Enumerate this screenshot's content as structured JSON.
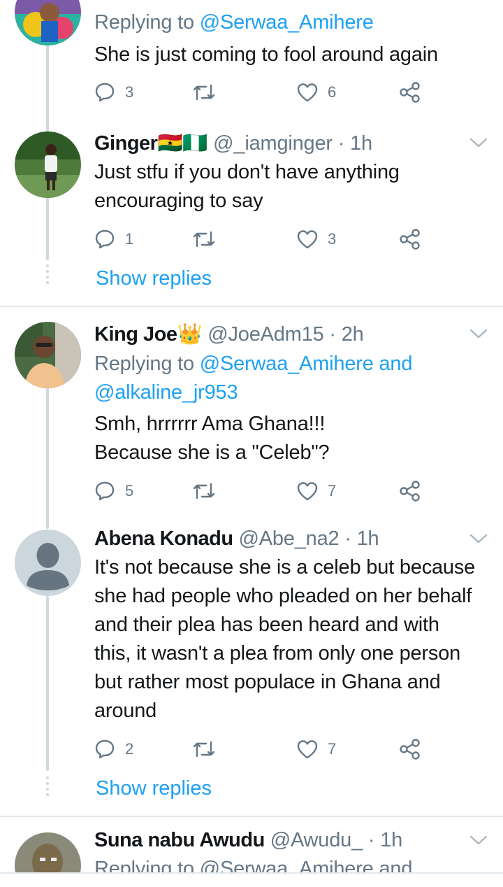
{
  "tweet1": {
    "reply_prefix": "Replying to ",
    "reply_mention": "@Serwaa_Amihere",
    "lines": [
      "She is just coming to fool around again"
    ],
    "replies": "3",
    "likes": "6"
  },
  "tweet2": {
    "name": "Ginger",
    "name_emoji": "🇬🇭🇳🇬",
    "handle_time": "@_iamginger · 1h",
    "lines": [
      "Just stfu if you don't have anything",
      "encouraging to say"
    ],
    "replies": "1",
    "likes": "3",
    "show_replies": "Show replies"
  },
  "tweet3": {
    "name": "King Joe",
    "name_emoji": "👑",
    "handle_time": "@JoeAdm15 · 2h",
    "reply_prefix": "Replying to ",
    "reply_mention_1": "@Serwaa_Amihere",
    "reply_and": " and",
    "reply_mention_2": "@alkaline_jr953",
    "lines": [
      "Smh, hrrrrrr Ama Ghana!!!",
      "Because she is a \"Celeb\"?"
    ],
    "replies": "5",
    "likes": "7"
  },
  "tweet4": {
    "name": "Abena Konadu",
    "handle_time": "@Abe_na2 · 1h",
    "lines": [
      "It's not because she is a celeb but because",
      "she had people who pleaded on her behalf",
      "and their plea has been heard and with",
      "this, it wasn't a plea from only one person",
      "but rather most populace in Ghana and",
      "around"
    ],
    "replies": "2",
    "likes": "7",
    "show_replies": "Show replies"
  },
  "tweet5": {
    "name": "Suna nabu Awudu",
    "handle_time": "@Awudu_ · 1h",
    "reply_partial": "Replying to @Serwaa_Amihere and"
  },
  "icons": {
    "reply": "reply-icon",
    "retweet": "retweet-icon",
    "like": "heart-icon",
    "share": "share-icon",
    "more": "chevron-down-icon"
  },
  "colors": {
    "accent": "#1da1f2",
    "muted": "#657786",
    "text": "#14171a",
    "thread": "#cfd9de"
  }
}
